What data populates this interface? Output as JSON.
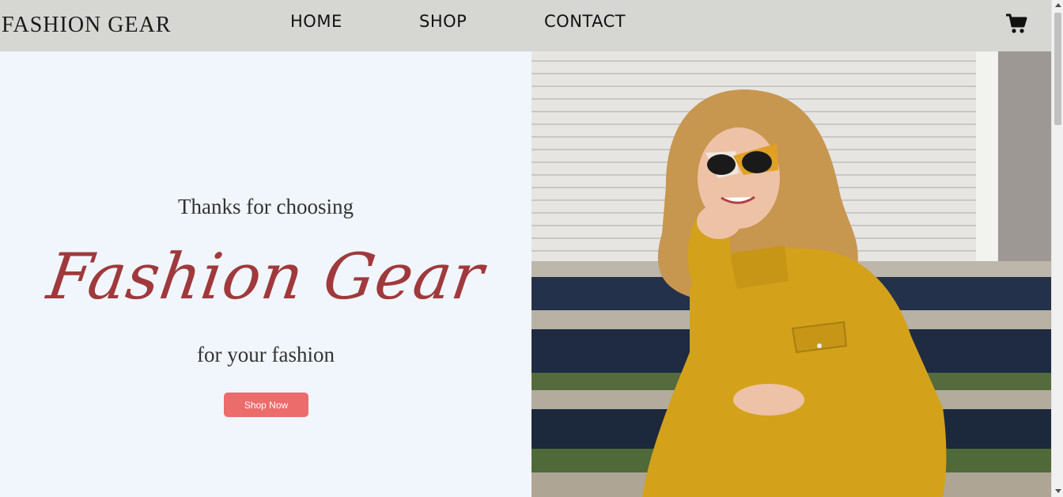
{
  "navbar": {
    "brand": "FASHION GEAR",
    "links": [
      "HOME",
      "SHOP",
      "CONTACT"
    ],
    "cart_icon": "shopping-cart-icon"
  },
  "hero": {
    "pre_title": "Thanks for choosing",
    "title": "Fashion Gear",
    "subtitle": "for your fashion",
    "cta_label": "Shop Now"
  },
  "colors": {
    "navbar_bg": "#d6d6d2",
    "hero_bg": "#f0f6fc",
    "title": "#a0393c",
    "cta_bg": "#ec6b6b"
  }
}
